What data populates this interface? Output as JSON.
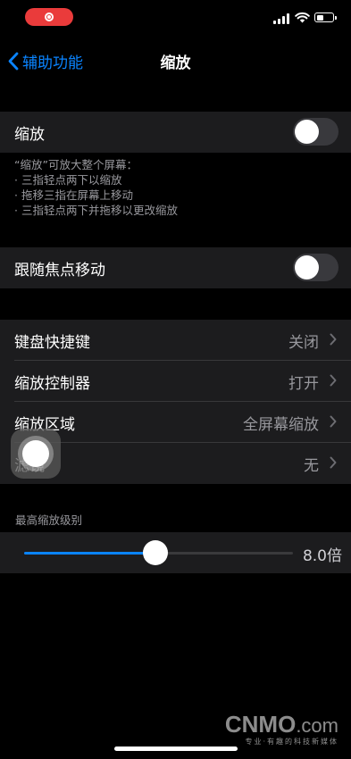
{
  "status_bar": {
    "recording_color": "#ea3b3b",
    "icons": [
      "record-icon",
      "signal-icon",
      "wifi-icon",
      "battery-icon"
    ]
  },
  "nav": {
    "back_label": "辅助功能",
    "title": "缩放"
  },
  "zoom_group": {
    "label": "缩放",
    "toggle_on": false
  },
  "zoom_footer": {
    "line1": "“缩放”可放大整个屏幕：",
    "line2": "· 三指轻点两下以缩放",
    "line3": "· 拖移三指在屏幕上移动",
    "line4": "· 三指轻点两下并拖移以更改缩放"
  },
  "follow_focus": {
    "label": "跟随焦点移动",
    "toggle_on": false
  },
  "options": [
    {
      "label": "键盘快捷键",
      "value": "关闭"
    },
    {
      "label": "缩放控制器",
      "value": "打开"
    },
    {
      "label": "缩放区域",
      "value": "全屏幕缩放"
    },
    {
      "label": "滤镜",
      "value": "无"
    }
  ],
  "max_zoom": {
    "header": "最高缩放级别",
    "value_text": "8.0倍",
    "level_fraction": 0.49
  },
  "watermark": {
    "logo_main": "CNMO",
    "logo_suffix": ".com",
    "tagline": "专业·有趣的科技新媒体"
  },
  "colors": {
    "accent": "#0a84ff",
    "cell_background": "#1c1c1e",
    "secondary_text": "#98989d"
  }
}
